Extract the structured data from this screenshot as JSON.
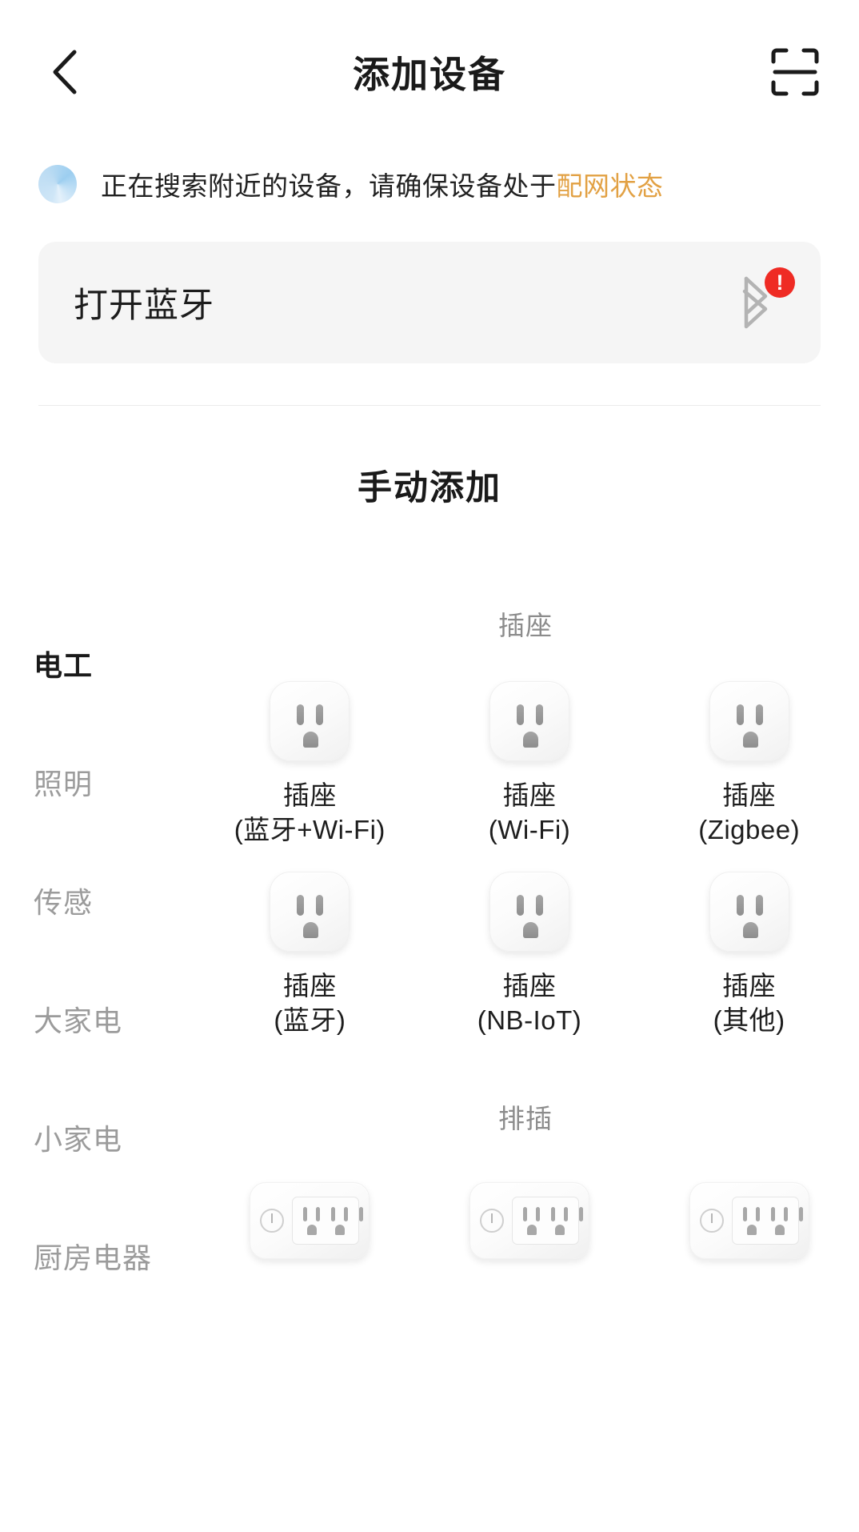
{
  "header": {
    "title": "添加设备",
    "back_icon": "chevron-left-icon",
    "scan_icon": "scan-qr-icon"
  },
  "status": {
    "icon": "loading-spinner-icon",
    "text_normal": "正在搜索附近的设备，请确保设备处于",
    "text_highlight": "配网状态",
    "highlight_color": "#e2a144"
  },
  "bluetooth_card": {
    "label": "打开蓝牙",
    "icon": "bluetooth-icon",
    "badge": "!",
    "badge_color": "#ef2b24"
  },
  "manual": {
    "title": "手动添加"
  },
  "sidebar": {
    "items": [
      {
        "label": "电工",
        "active": true
      },
      {
        "label": "照明",
        "active": false
      },
      {
        "label": "传感",
        "active": false
      },
      {
        "label": "大家电",
        "active": false
      },
      {
        "label": "小家电",
        "active": false
      },
      {
        "label": "厨房电器",
        "active": false
      }
    ]
  },
  "groups": [
    {
      "title": "插座",
      "items": [
        {
          "name": "插座",
          "variant": "(蓝牙+Wi-Fi)",
          "icon": "socket-icon"
        },
        {
          "name": "插座",
          "variant": "(Wi-Fi)",
          "icon": "socket-icon"
        },
        {
          "name": "插座",
          "variant": "(Zigbee)",
          "icon": "socket-icon"
        },
        {
          "name": "插座",
          "variant": "(蓝牙)",
          "icon": "socket-icon"
        },
        {
          "name": "插座",
          "variant": "(NB-IoT)",
          "icon": "socket-icon"
        },
        {
          "name": "插座",
          "variant": "(其他)",
          "icon": "socket-icon"
        }
      ]
    },
    {
      "title": "排插",
      "items": [
        {
          "name": "",
          "variant": "",
          "icon": "power-strip-icon"
        },
        {
          "name": "",
          "variant": "",
          "icon": "power-strip-icon"
        },
        {
          "name": "",
          "variant": "",
          "icon": "power-strip-icon"
        }
      ]
    }
  ]
}
